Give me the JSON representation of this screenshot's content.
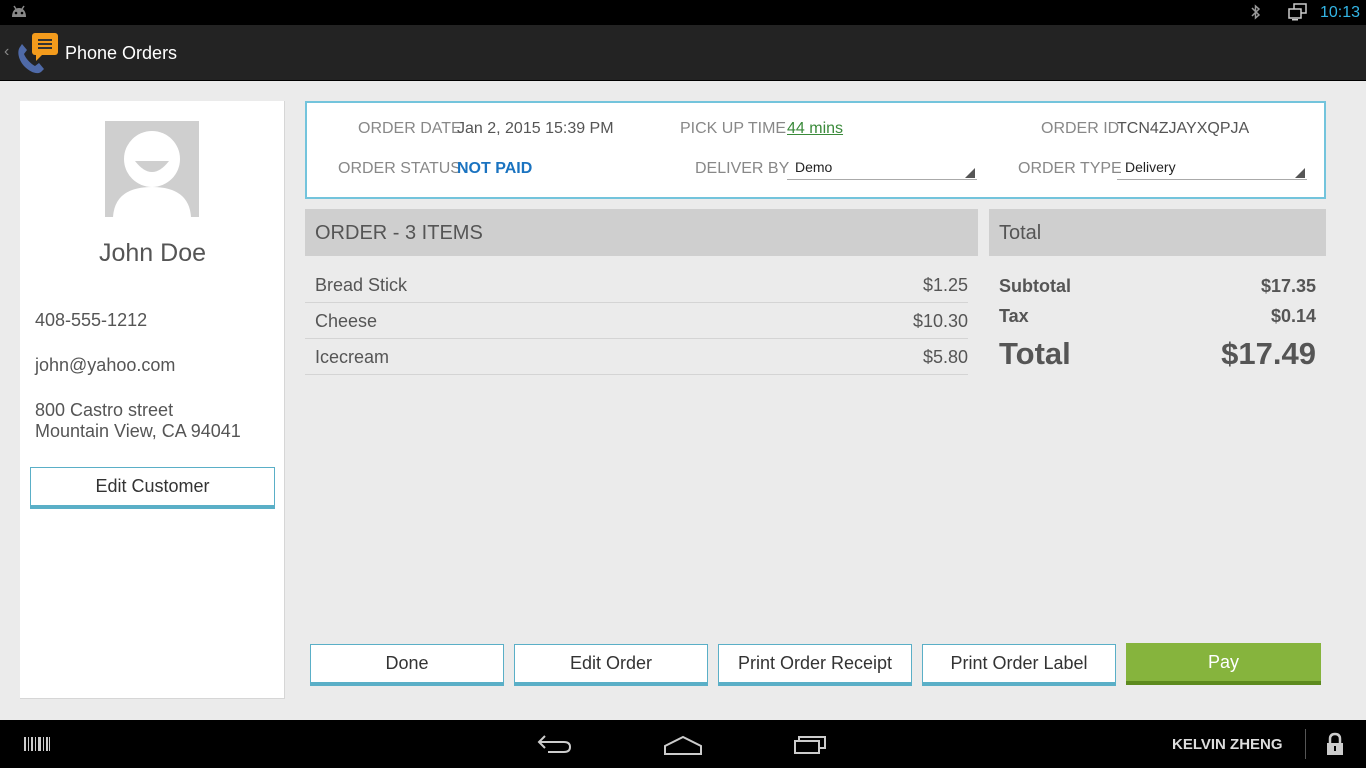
{
  "status_bar": {
    "time": "10:13"
  },
  "app": {
    "title": "Phone Orders"
  },
  "customer": {
    "name": "John Doe",
    "phone": "408-555-1212",
    "email": "john@yahoo.com",
    "address_line1": "800 Castro street",
    "address_line2": "Mountain View, CA 94041",
    "edit_button": "Edit Customer"
  },
  "order_info": {
    "order_date_label": "ORDER DATE",
    "order_date": "Jan 2, 2015 15:39 PM",
    "pickup_label": "PICK UP TIME",
    "pickup_time": "44 mins",
    "order_id_label": "ORDER ID",
    "order_id": "TCN4ZJAYXQPJA",
    "status_label": "ORDER STATUS",
    "status": "NOT PAID",
    "deliver_by_label": "DELIVER BY",
    "deliver_by": "Demo",
    "order_type_label": "ORDER TYPE",
    "order_type": "Delivery"
  },
  "order": {
    "header": "ORDER - 3 ITEMS",
    "items": [
      {
        "name": "Bread Stick",
        "price": "$1.25"
      },
      {
        "name": "Cheese",
        "price": "$10.30"
      },
      {
        "name": "Icecream",
        "price": "$5.80"
      }
    ]
  },
  "totals": {
    "header": "Total",
    "subtotal_label": "Subtotal",
    "subtotal": "$17.35",
    "tax_label": "Tax",
    "tax": "$0.14",
    "total_label": "Total",
    "total": "$17.49"
  },
  "actions": {
    "done": "Done",
    "edit_order": "Edit Order",
    "print_receipt": "Print Order Receipt",
    "print_label": "Print Order Label",
    "pay": "Pay"
  },
  "nav_bar": {
    "user": "KELVIN ZHENG"
  },
  "colors": {
    "accent_blue": "#5aafc7",
    "pay_green": "#86b43d",
    "status_blue": "#1a73c0",
    "pickup_green": "#3a8a3a",
    "clock_blue": "#33b5e5"
  },
  "icons": [
    "android-icon",
    "bluetooth-icon",
    "network-icon",
    "phone-orders-app-icon",
    "barcode-icon",
    "back-icon",
    "home-icon",
    "recents-icon",
    "lock-icon"
  ]
}
